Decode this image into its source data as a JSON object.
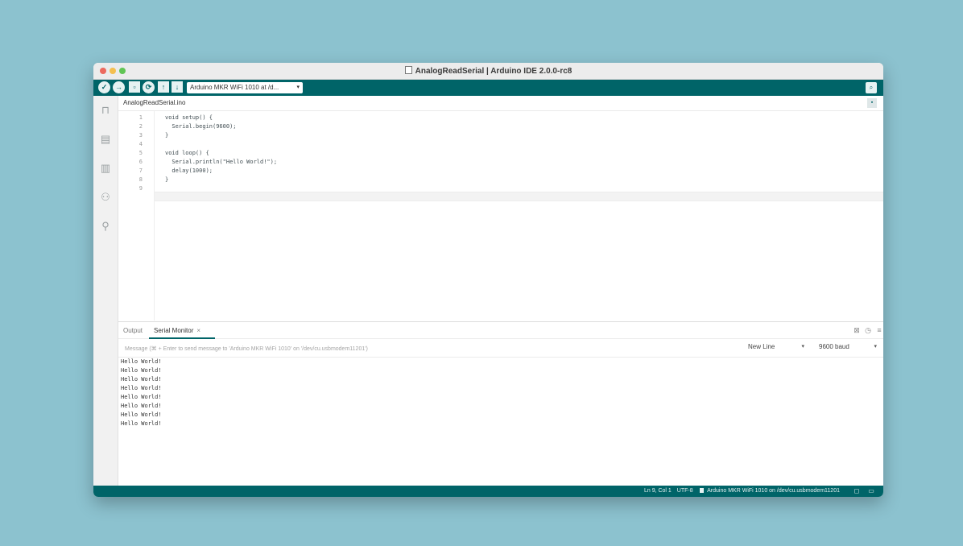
{
  "window": {
    "title": "AnalogReadSerial | Arduino IDE 2.0.0-rc8"
  },
  "toolbar": {
    "verify_icon": "check-icon",
    "upload_icon": "arrow-right-icon",
    "debug_icon": "debug-icon",
    "board_selector": "Arduino MKR WiFi 1010 at /d...",
    "board_caret": "▾"
  },
  "sidebar": {
    "items": [
      {
        "name": "sketchbook-icon",
        "glyph": "🗀"
      },
      {
        "name": "boards-manager-icon",
        "glyph": "▤"
      },
      {
        "name": "library-manager-icon",
        "glyph": "▥"
      },
      {
        "name": "debug-icon",
        "glyph": "⚇"
      },
      {
        "name": "search-icon",
        "glyph": "⚲"
      }
    ]
  },
  "editor": {
    "file_tab": "AnalogReadSerial.ino",
    "lines": [
      {
        "n": "1",
        "code": "void setup() {"
      },
      {
        "n": "2",
        "code": "  Serial.begin(9600);"
      },
      {
        "n": "3",
        "code": "}"
      },
      {
        "n": "4",
        "code": ""
      },
      {
        "n": "5",
        "code": "void loop() {"
      },
      {
        "n": "6",
        "code": "  Serial.println(\"Hello World!\");"
      },
      {
        "n": "7",
        "code": "  delay(1000);"
      },
      {
        "n": "8",
        "code": "}"
      },
      {
        "n": "9",
        "code": ""
      }
    ]
  },
  "panel": {
    "tabs": {
      "output": "Output",
      "serial_monitor": "Serial Monitor",
      "close": "×"
    },
    "message_placeholder": "Message (⌘ + Enter to send message to 'Arduino MKR WiFi 1010' on '/dev/cu.usbmodem11201')",
    "line_ending": "New Line",
    "baud_rate": "9600 baud",
    "caret": "▾",
    "output_lines": [
      "Hello World!",
      "Hello World!",
      "Hello World!",
      "Hello World!",
      "Hello World!",
      "Hello World!",
      "Hello World!",
      "Hello World!"
    ]
  },
  "status": {
    "cursor": "Ln 9, Col 1",
    "encoding": "UTF-8",
    "board": "Arduino MKR WiFi 1010 on /dev/cu.usbmodem11201"
  }
}
